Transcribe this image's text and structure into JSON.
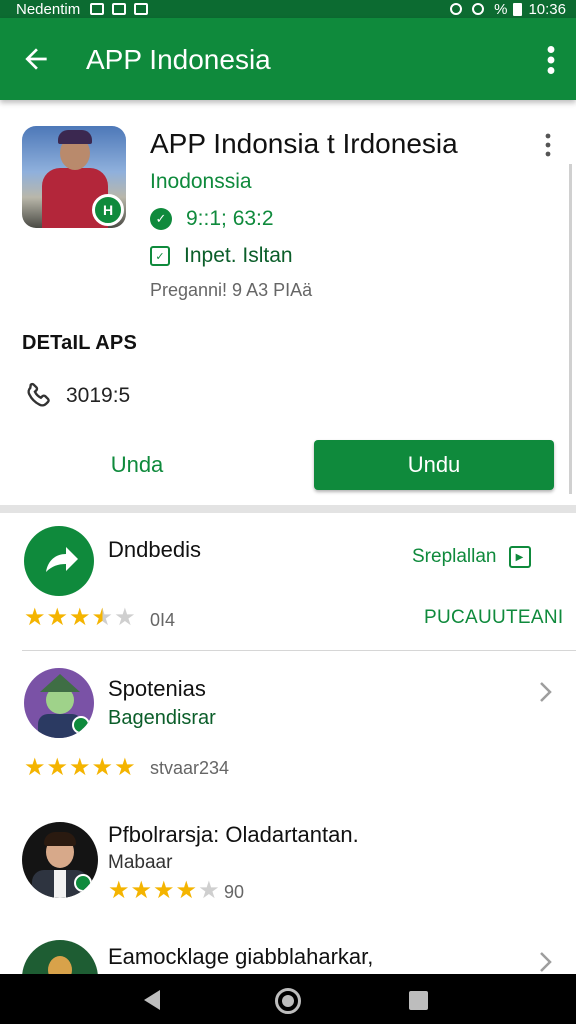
{
  "status_bar": {
    "carrier": "Nedentim",
    "battery": "%",
    "time": "10:36"
  },
  "app_bar": {
    "title": "APP Indonesia",
    "icons": [
      "back-arrow-icon",
      "more-vert-icon"
    ]
  },
  "app": {
    "title": "APP Indonsia t Irdonesia",
    "developer": "Inodonssia",
    "verified_text": "9::1; 63:2",
    "category": "Inpet. Isltan",
    "meta": "Preganni! 9 A3 PIAä",
    "icon_badge": "H"
  },
  "details": {
    "heading": "DETaIL APS",
    "phone": "3019:5"
  },
  "buttons": {
    "secondary": "Unda",
    "primary": "Undu"
  },
  "list": [
    {
      "title": "Dndbedis",
      "action": "Sreplallan",
      "rating_count": "0I4",
      "right_label": "PUCAUUTEANI",
      "rating": 3.5
    },
    {
      "title": "Spotenias",
      "subtitle": "Bagendisrar",
      "rating_count": "stvaar234",
      "rating": 5
    },
    {
      "title": "Pfbolrarsja: Oladartantan.",
      "subtitle": "Mabaar",
      "rating_count": "90",
      "rating": 4
    },
    {
      "title": "Eamocklage giabblaharkar,"
    }
  ],
  "colors": {
    "primary_green": "#0f8a3c",
    "status_bar_green": "#0c6b31",
    "star": "#f4b400"
  }
}
